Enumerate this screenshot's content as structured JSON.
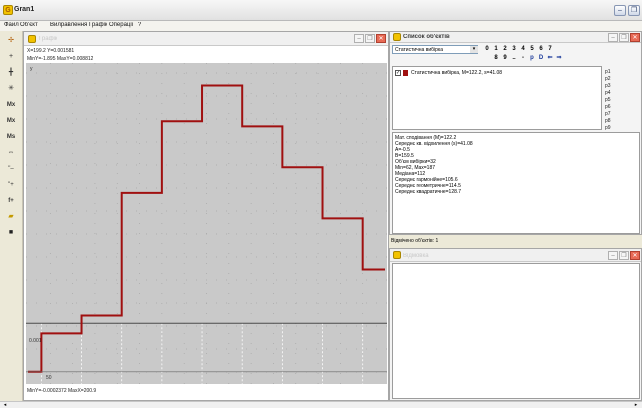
{
  "app": {
    "title": "Gran1"
  },
  "menu": [
    "Файл",
    "Об'єкт",
    "Вилравлення",
    "Графік",
    "Операції",
    "?"
  ],
  "toolbar": {
    "icons": [
      "pin-icon",
      "plus-icon",
      "cross-zoom-icon",
      "asterisk-icon",
      "mx-icon",
      "mx-sub-icon",
      "ms-icon",
      "arrow-move-icon",
      "minus-cursor-icon",
      "plus-cursor-icon",
      "fx-icon",
      "open-folder-icon",
      "save-icon"
    ],
    "labels": [
      "Mx",
      "Mx",
      "Ms",
      "⇔",
      "\"–",
      "\"+",
      "f+"
    ]
  },
  "graph_window": {
    "title": "Графік",
    "coords": "X=199.2  Y=0.001581",
    "range_top": "MinY=-1.895  MaxY=0.008812",
    "range_bottom": "MinY=-0.0002372  MaxX=200.9",
    "y_label_top": "y",
    "y_label_mid": "0.001",
    "x_label_left": "50"
  },
  "chart_data": {
    "type": "line",
    "step": true,
    "x": [
      46,
      64,
      82,
      100,
      118,
      136,
      154,
      172,
      190
    ],
    "values": [
      0.0,
      0.00075,
      0.0011,
      0.0035,
      0.0049,
      0.0056,
      0.0048,
      0.004,
      0.003,
      0.002
    ],
    "xlim": [
      40,
      200
    ],
    "ylim": [
      -0.0002,
      0.006
    ],
    "hline": 0.00095,
    "title": "",
    "xlabel": "",
    "ylabel": "",
    "grid": true,
    "colors": {
      "line": "#a01010",
      "hline": "#4a4a4a",
      "background": "#c9c9c9"
    }
  },
  "objects_window": {
    "title": "Список об'єктів",
    "combo_value": "Статистична вибірка",
    "num_row1": [
      "0",
      "1",
      "2",
      "3",
      "4",
      "5",
      "6",
      "7"
    ],
    "num_row2": [
      "8",
      "9",
      "..",
      "-",
      "p",
      "D",
      "⇐",
      "⇒"
    ],
    "list_item": "Статистична вибірка, M=122.2, s=41.08",
    "side_items": [
      "p1",
      "p2",
      "p3",
      "p4",
      "p5",
      "p6",
      "p7",
      "p8",
      "p9"
    ],
    "stats": [
      "Мат. сподівання (M)=122.2",
      "Середнє кв. відхилення (s)=41.08",
      "A=-0.5",
      "B=159.5",
      "Об'єм вибірки=32",
      "Min=62, Max=187",
      "Медіана=112",
      "Середнє гармонійне=105.6",
      "Середнє геометричне=114.5",
      "Середнє квадратичне=128.7"
    ],
    "status": "Відмічено об'єктів: 1"
  },
  "results_window": {
    "title": "Відмовка"
  }
}
